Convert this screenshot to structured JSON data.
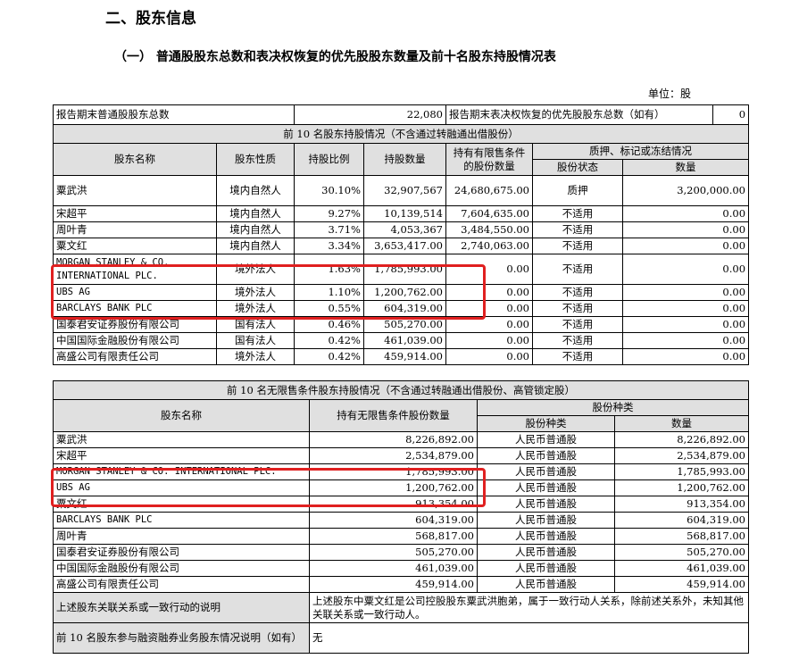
{
  "section_title": "二、股东信息",
  "subsection_title": "（一）  普通股股东总数和表决权恢复的优先股股东数量及前十名股东持股情况表",
  "unit": "单位：股",
  "summary": {
    "label_common": "报告期末普通股股东总数",
    "value_common": "22,080",
    "label_pref": "报告期末表决权恢复的优先股股东总数（如有）",
    "value_pref": "0"
  },
  "top10": {
    "title": "前 10 名股东持股情况（不含通过转融通出借股份）",
    "headers": {
      "name": "股东名称",
      "nature": "股东性质",
      "ratio": "持股比例",
      "qty": "持股数量",
      "restricted": "持有有限售条件的股份数量",
      "pledge_group": "质押、标记或冻结情况",
      "pledge_status": "股份状态",
      "pledge_qty": "数量"
    },
    "rows": [
      {
        "name": "粟武洪",
        "nature": "境内自然人",
        "ratio": "30.10%",
        "qty": "32,907,567",
        "restricted": "24,680,675.00",
        "status": "质押",
        "pledged": "3,200,000.00"
      },
      {
        "name": "宋超平",
        "nature": "境内自然人",
        "ratio": "9.27%",
        "qty": "10,139,514",
        "restricted": "7,604,635.00",
        "status": "不适用",
        "pledged": "0.00"
      },
      {
        "name": "周叶青",
        "nature": "境内自然人",
        "ratio": "3.71%",
        "qty": "4,053,367",
        "restricted": "3,484,550.00",
        "status": "不适用",
        "pledged": "0.00"
      },
      {
        "name": "粟文红",
        "nature": "境内自然人",
        "ratio": "3.34%",
        "qty": "3,653,417.00",
        "restricted": "2,740,063.00",
        "status": "不适用",
        "pledged": "0.00"
      },
      {
        "name": "MORGAN STANLEY & CO. INTERNATIONAL PLC.",
        "nature": "境外法人",
        "ratio": "1.63%",
        "qty": "1,785,993.00",
        "restricted": "0.00",
        "status": "不适用",
        "pledged": "0.00"
      },
      {
        "name": "UBS    AG",
        "nature": "境外法人",
        "ratio": "1.10%",
        "qty": "1,200,762.00",
        "restricted": "0.00",
        "status": "不适用",
        "pledged": "0.00"
      },
      {
        "name": "BARCLAYS BANK PLC",
        "nature": "境外法人",
        "ratio": "0.55%",
        "qty": "604,319.00",
        "restricted": "0.00",
        "status": "不适用",
        "pledged": "0.00"
      },
      {
        "name": "国泰君安证券股份有限公司",
        "nature": "国有法人",
        "ratio": "0.46%",
        "qty": "505,270.00",
        "restricted": "0.00",
        "status": "不适用",
        "pledged": "0.00"
      },
      {
        "name": "中国国际金融股份有限公司",
        "nature": "国有法人",
        "ratio": "0.42%",
        "qty": "461,039.00",
        "restricted": "0.00",
        "status": "不适用",
        "pledged": "0.00"
      },
      {
        "name": "高盛公司有限责任公司",
        "nature": "境外法人",
        "ratio": "0.42%",
        "qty": "459,914.00",
        "restricted": "0.00",
        "status": "不适用",
        "pledged": "0.00"
      }
    ]
  },
  "unrestricted": {
    "title": "前 10 名无限售条件股东持股情况（不含通过转融通出借股份、高管锁定股）",
    "headers": {
      "name": "股东名称",
      "qty": "持有无限售条件股份数量",
      "type_group": "股份种类",
      "type": "股份种类",
      "type_qty": "数量"
    },
    "rows": [
      {
        "name": "粟武洪",
        "qty": "8,226,892.00",
        "type": "人民币普通股",
        "tqty": "8,226,892.00"
      },
      {
        "name": "宋超平",
        "qty": "2,534,879.00",
        "type": "人民币普通股",
        "tqty": "2,534,879.00"
      },
      {
        "name": "MORGAN STANLEY & CO. INTERNATIONAL PLC.",
        "qty": "1,785,993.00",
        "type": "人民币普通股",
        "tqty": "1,785,993.00"
      },
      {
        "name": "UBS AG",
        "qty": "1,200,762.00",
        "type": "人民币普通股",
        "tqty": "1,200,762.00"
      },
      {
        "name": "粟文红",
        "qty": "913,354.00",
        "type": "人民币普通股",
        "tqty": "913,354.00"
      },
      {
        "name": "BARCLAYS BANK PLC",
        "qty": "604,319.00",
        "type": "人民币普通股",
        "tqty": "604,319.00"
      },
      {
        "name": "周叶青",
        "qty": "568,817.00",
        "type": "人民币普通股",
        "tqty": "568,817.00"
      },
      {
        "name": "国泰君安证券股份有限公司",
        "qty": "505,270.00",
        "type": "人民币普通股",
        "tqty": "505,270.00"
      },
      {
        "name": "中国国际金融股份有限公司",
        "qty": "461,039.00",
        "type": "人民币普通股",
        "tqty": "461,039.00"
      },
      {
        "name": "高盛公司有限责任公司",
        "qty": "459,914.00",
        "type": "人民币普通股",
        "tqty": "459,914.00"
      }
    ]
  },
  "notes": {
    "related_label": "上述股东关联关系或一致行动的说明",
    "related_text": "上述股东中粟文红是公司控股股东粟武洪胞弟，属于一致行动人关系，除前述关系外，未知其他关联关系或一致行动人。",
    "margin_label": "前 10 名股东参与融资融券业务股东情况说明（如有）",
    "margin_text": "无"
  },
  "highlight_color": "#e02020"
}
